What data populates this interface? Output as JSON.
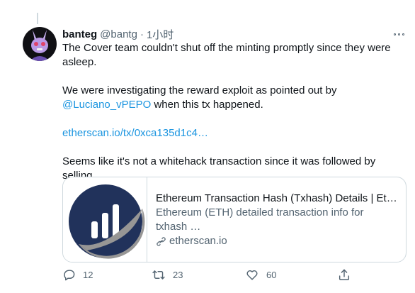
{
  "tweet": {
    "author_name": "banteg",
    "author_handle": "@bantg",
    "separator": "·",
    "timestamp": "1小时",
    "avatar_icon": "purple-bunny-avatar",
    "paragraphs": {
      "p1": "The Cover team couldn't shut off the minting promptly since they were asleep.",
      "p2_before": "We were investigating the reward exploit as pointed out by ",
      "p2_mention": "@Luciano_vPEPO",
      "p2_after": " when this tx happened.",
      "p3_link": "etherscan.io/tx/0xca135d1c4…",
      "p4": "Seems like it's not a whitehack transaction since it was followed by selling."
    },
    "link_card": {
      "title": "Ethereum Transaction Hash (Txhash) Details | Et…",
      "description": "Ethereum (ETH) detailed transaction info for txhash …",
      "domain": "etherscan.io",
      "thumbnail_icon": "etherscan-logo"
    },
    "actions": {
      "replies": "12",
      "retweets": "23",
      "likes": "60"
    },
    "colors": {
      "link": "#1b95e0",
      "text": "#0f1419",
      "muted": "#536471",
      "border": "#cfd9de",
      "etherscan_blue": "#21325b",
      "etherscan_gray": "#979695"
    }
  }
}
